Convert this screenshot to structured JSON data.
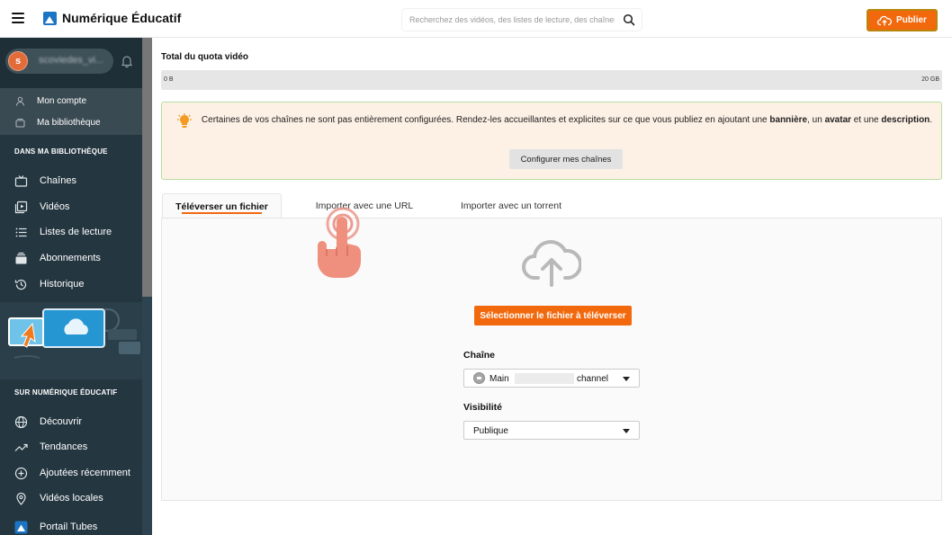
{
  "topbar": {
    "brand_name": "Numérique Éducatif",
    "search_placeholder": "Recherchez des vidéos, des listes de lecture, des chaînes",
    "publish_label": "Publier"
  },
  "sidebar": {
    "user": {
      "initial": "s",
      "name": "scoviedes_vi..."
    },
    "account_items": [
      {
        "label": "Mon compte",
        "icon": "user-icon"
      },
      {
        "label": "Ma bibliothèque",
        "icon": "library-icon"
      }
    ],
    "section_library": "DANS MA BIBLIOTHÈQUE",
    "library_items": [
      {
        "label": "Chaînes",
        "icon": "tv-icon"
      },
      {
        "label": "Vidéos",
        "icon": "videos-icon"
      },
      {
        "label": "Listes de lecture",
        "icon": "list-icon"
      },
      {
        "label": "Abonnements",
        "icon": "subscriptions-icon"
      },
      {
        "label": "Historique",
        "icon": "history-icon"
      }
    ],
    "section_site": "SUR NUMÉRIQUE ÉDUCATIF",
    "site_items": [
      {
        "label": "Découvrir",
        "icon": "globe-icon"
      },
      {
        "label": "Tendances",
        "icon": "trending-icon"
      },
      {
        "label": "Ajoutées récemment",
        "icon": "plus-circle-icon"
      },
      {
        "label": "Vidéos locales",
        "icon": "location-icon"
      },
      {
        "label": "Portail Tubes",
        "icon": "portal-icon"
      }
    ]
  },
  "quota": {
    "title": "Total du quota vidéo",
    "min": "0 B",
    "max": "20 GB"
  },
  "alert": {
    "text_1": "Certaines de vos chaînes ne sont pas entièrement configurées. Rendez-les accueillantes et explicites sur ce que vous publiez en ajoutant une ",
    "bold_1": "bannière",
    "text_2": ", un ",
    "bold_2": "avatar",
    "text_3": " et une ",
    "bold_3": "description",
    "text_4": ".",
    "button": "Configurer mes chaînes"
  },
  "tabs": [
    {
      "label": "Téléverser un fichier",
      "active": true
    },
    {
      "label": "Importer avec une URL",
      "active": false
    },
    {
      "label": "Importer avec un torrent",
      "active": false
    }
  ],
  "upload": {
    "select_button": "Sélectionner le fichier à téléverser",
    "channel_label": "Chaîne",
    "channel_value_start": "Main",
    "channel_value_end": "channel",
    "visibility_label": "Visibilité",
    "visibility_value": "Publique"
  },
  "colors": {
    "accent": "#f2690d",
    "sidebar_bg": "#243640",
    "alert_bg": "#fdf1e6",
    "alert_border": "#b6dfa0"
  }
}
